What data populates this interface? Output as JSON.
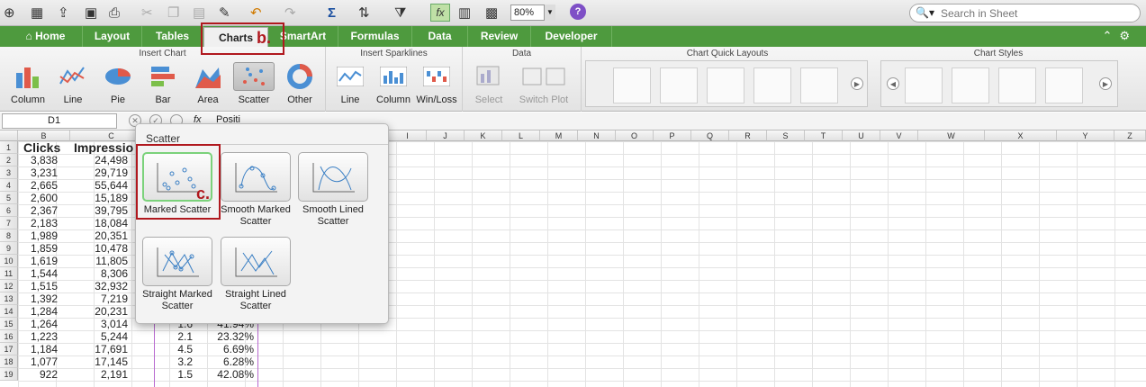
{
  "toolbar": {
    "zoom": "80%",
    "search_placeholder": "Search in Sheet"
  },
  "tabs": [
    "Home",
    "Layout",
    "Tables",
    "Charts",
    "SmartArt",
    "Formulas",
    "Data",
    "Review",
    "Developer"
  ],
  "active_tab": "Charts",
  "ribbon": {
    "groups": {
      "insert_chart": "Insert Chart",
      "insert_sparklines": "Insert Sparklines",
      "data": "Data",
      "quick_layouts": "Chart Quick Layouts",
      "styles": "Chart Styles"
    },
    "chart_buttons": [
      "Column",
      "Line",
      "Pie",
      "Bar",
      "Area",
      "Scatter",
      "Other"
    ],
    "sparkline_buttons": [
      "Line",
      "Column",
      "Win/Loss"
    ],
    "data_buttons": [
      "Select",
      "Switch Plot"
    ]
  },
  "formula_bar": {
    "name_box": "D1",
    "fx": "fx",
    "value": "Positi"
  },
  "columns": [
    "B",
    "C",
    "I",
    "J",
    "K",
    "L",
    "M",
    "N",
    "O",
    "P",
    "Q",
    "R",
    "S",
    "T",
    "U",
    "V",
    "W",
    "X",
    "Y",
    "Z"
  ],
  "headers": {
    "clicks": "Clicks",
    "impressions": "Impressio"
  },
  "rows": [
    {
      "n": "1"
    },
    {
      "n": "2",
      "b": "3,838",
      "c": "24,498"
    },
    {
      "n": "3",
      "b": "3,231",
      "c": "29,719"
    },
    {
      "n": "4",
      "b": "2,665",
      "c": "55,644"
    },
    {
      "n": "5",
      "b": "2,600",
      "c": "15,189"
    },
    {
      "n": "6",
      "b": "2,367",
      "c": "39,795"
    },
    {
      "n": "7",
      "b": "2,183",
      "c": "18,084"
    },
    {
      "n": "8",
      "b": "1,989",
      "c": "20,351"
    },
    {
      "n": "9",
      "b": "1,859",
      "c": "10,478"
    },
    {
      "n": "10",
      "b": "1,619",
      "c": "11,805"
    },
    {
      "n": "11",
      "b": "1,544",
      "c": "8,306"
    },
    {
      "n": "12",
      "b": "1,515",
      "c": "32,932"
    },
    {
      "n": "13",
      "b": "1,392",
      "c": "7,219"
    },
    {
      "n": "14",
      "b": "1,284",
      "c": "20,231"
    },
    {
      "n": "15",
      "b": "1,264",
      "c": "3,014",
      "d": "1.6",
      "e": "41.94%"
    },
    {
      "n": "16",
      "b": "1,223",
      "c": "5,244",
      "d": "2.1",
      "e": "23.32%"
    },
    {
      "n": "17",
      "b": "1,184",
      "c": "17,691",
      "d": "4.5",
      "e": "6.69%"
    },
    {
      "n": "18",
      "b": "1,077",
      "c": "17,145",
      "d": "3.2",
      "e": "6.28%"
    },
    {
      "n": "19",
      "b": "922",
      "c": "2,191",
      "d": "1.5",
      "e": "42.08%"
    }
  ],
  "scatter_menu": {
    "title": "Scatter",
    "options": [
      "Marked Scatter",
      "Smooth Marked Scatter",
      "Smooth Lined Scatter",
      "Straight Marked Scatter",
      "Straight Lined Scatter"
    ]
  },
  "callouts": {
    "b": "b.",
    "c": "c."
  }
}
